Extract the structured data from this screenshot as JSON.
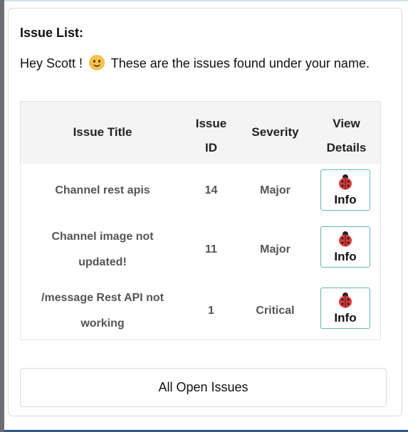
{
  "card": {
    "title": "Issue List:",
    "greeting_prefix": "Hey Scott !",
    "greeting_suffix": "These are the issues found under your name."
  },
  "table": {
    "headers": {
      "title": "Issue Title",
      "id_line1": "Issue",
      "id_line2": "ID",
      "severity": "Severity",
      "view_line1": "View",
      "view_line2": "Details"
    },
    "rows": [
      {
        "title_line1": "Channel rest apis",
        "title_line2": "",
        "id": "14",
        "severity": "Major",
        "button": "Info"
      },
      {
        "title_line1": "Channel image not",
        "title_line2": "updated!",
        "id": "11",
        "severity": "Major",
        "button": "Info"
      },
      {
        "title_line1": "/message Rest API not",
        "title_line2": "working",
        "id": "1",
        "severity": "Critical",
        "button": "Info"
      }
    ]
  },
  "footer": {
    "button_label": "All Open Issues"
  },
  "colors": {
    "header_bg": "#f4f4f4",
    "button_border": "#5fb8b2",
    "bug_red": "#e03a3a"
  }
}
